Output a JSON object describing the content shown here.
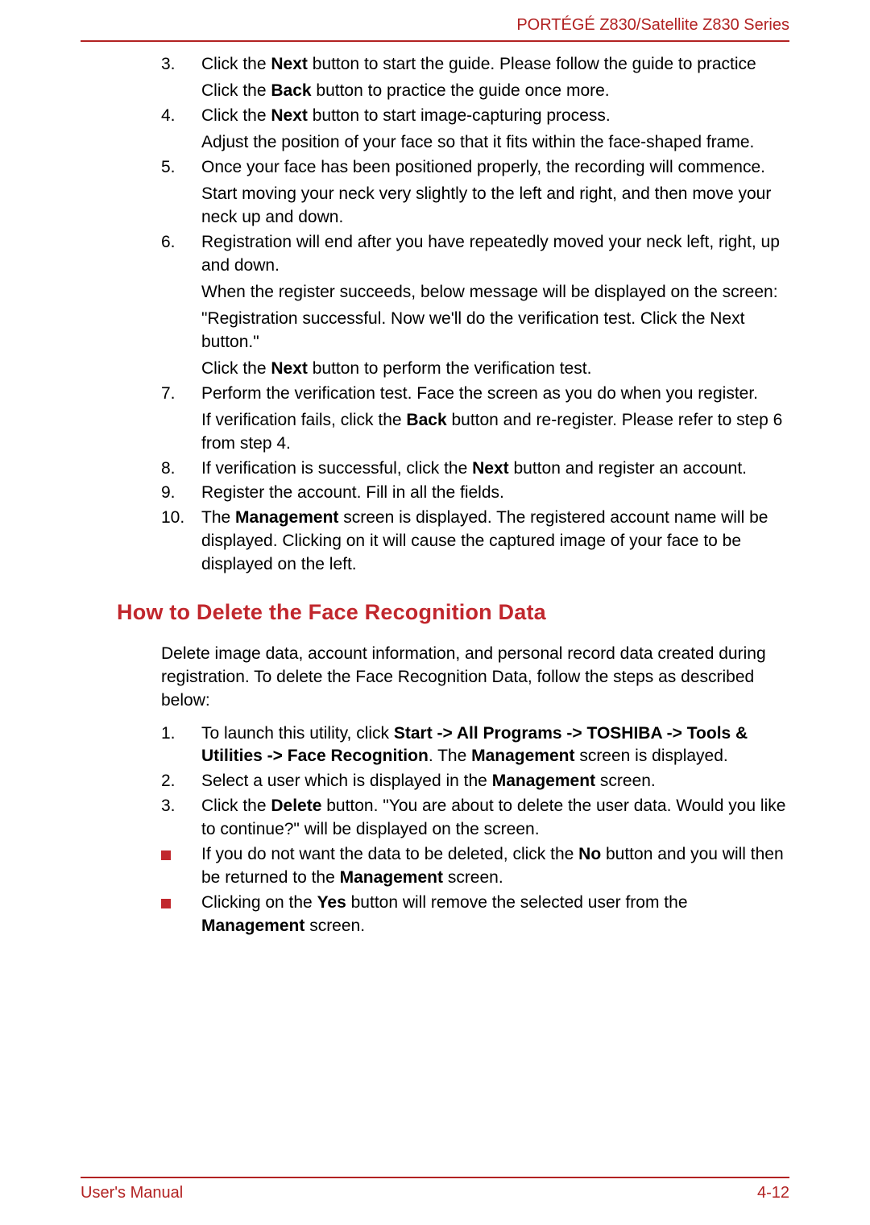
{
  "header": {
    "product": "PORTÉGÉ Z830/Satellite Z830 Series"
  },
  "footer": {
    "left": "User's Manual",
    "right": "4-12"
  },
  "list1": {
    "i3": {
      "num": "3.",
      "p1a": "Click the ",
      "p1b": "Next",
      "p1c": " button to start the guide. Please follow the guide to practice",
      "p2a": "Click the ",
      "p2b": "Back",
      "p2c": " button to practice the guide once more."
    },
    "i4": {
      "num": "4.",
      "p1a": "Click the ",
      "p1b": "Next",
      "p1c": " button to start image-capturing process.",
      "p2": "Adjust the position of your face so that it fits within the face-shaped frame."
    },
    "i5": {
      "num": "5.",
      "p1": "Once your face has been positioned properly, the recording will commence.",
      "p2": "Start moving your neck very slightly to the left and right, and then move your neck up and down."
    },
    "i6": {
      "num": "6.",
      "p1": "Registration will end after you have repeatedly moved your neck left, right, up and down.",
      "p2": "When the register succeeds, below message will be displayed on the screen:",
      "p3": "\"Registration successful. Now we'll do the verification test. Click the Next button.\"",
      "p4a": "Click the ",
      "p4b": "Next",
      "p4c": " button to perform the verification test."
    },
    "i7": {
      "num": "7.",
      "p1": "Perform the verification test. Face the screen as you do when you register.",
      "p2a": "If verification fails, click the ",
      "p2b": "Back",
      "p2c": " button and re-register. Please refer to step 6 from step 4."
    },
    "i8": {
      "num": "8.",
      "p1a": "If verification is successful, click the ",
      "p1b": "Next",
      "p1c": " button and register an account."
    },
    "i9": {
      "num": "9.",
      "p1": "Register the account. Fill in all the fields."
    },
    "i10": {
      "num": "10.",
      "p1a": "The ",
      "p1b": "Management",
      "p1c": " screen is displayed. The registered account name will be displayed. Clicking on it will cause the captured image of your face to be displayed on the left."
    }
  },
  "heading": "How to Delete the Face Recognition Data",
  "intro": "Delete image data, account information, and personal record data created during registration. To delete the Face Recognition Data, follow the steps as described below:",
  "list2": {
    "i1": {
      "num": "1.",
      "a": "To launch this utility, click ",
      "b": "Start -> All Programs -> TOSHIBA -> Tools & Utilities -> Face Recognition",
      "c": ". The ",
      "d": "Management",
      "e": " screen is displayed."
    },
    "i2": {
      "num": "2.",
      "a": "Select a user which is displayed in the ",
      "b": "Management",
      "c": " screen."
    },
    "i3": {
      "num": "3.",
      "a": "Click the ",
      "b": "Delete",
      "c": " button. \"You are about to delete the user data. Would you like to continue?\" will be displayed on the screen."
    }
  },
  "bullets": {
    "b1": {
      "a": "If you do not want the data to be deleted, click the ",
      "b": "No",
      "c": " button and you will then be returned to the ",
      "d": "Management",
      "e": " screen."
    },
    "b2": {
      "a": "Clicking on the ",
      "b": "Yes",
      "c": " button will remove the selected user from the ",
      "d": "Management",
      "e": " screen."
    }
  }
}
